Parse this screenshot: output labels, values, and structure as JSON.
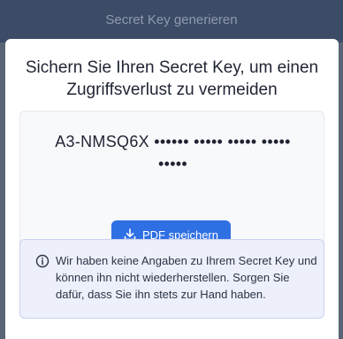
{
  "backdrop": {
    "title": "Secret Key generieren"
  },
  "dialog": {
    "title": "Sichern Sie Ihren Secret Key, um einen Zugriffsverlust zu vermeiden",
    "secret_key_display": "A3-NMSQ6X •••••• ••••• ••••• ••••• •••••",
    "save_pdf_label": "PDF speichern",
    "save_pdf_icon": "download-icon",
    "info_icon": "info-circle-icon",
    "info_text": "Wir haben keine Angaben zu Ihrem Secret Key und können ihn nicht wiederherstellen. Sorgen Sie dafür, dass Sie ihn stets zur Hand haben."
  },
  "colors": {
    "accent": "#2f6fe4",
    "info_background": "#edf0fb",
    "info_border": "#c9d1ee",
    "backdrop": "#5b6474"
  }
}
